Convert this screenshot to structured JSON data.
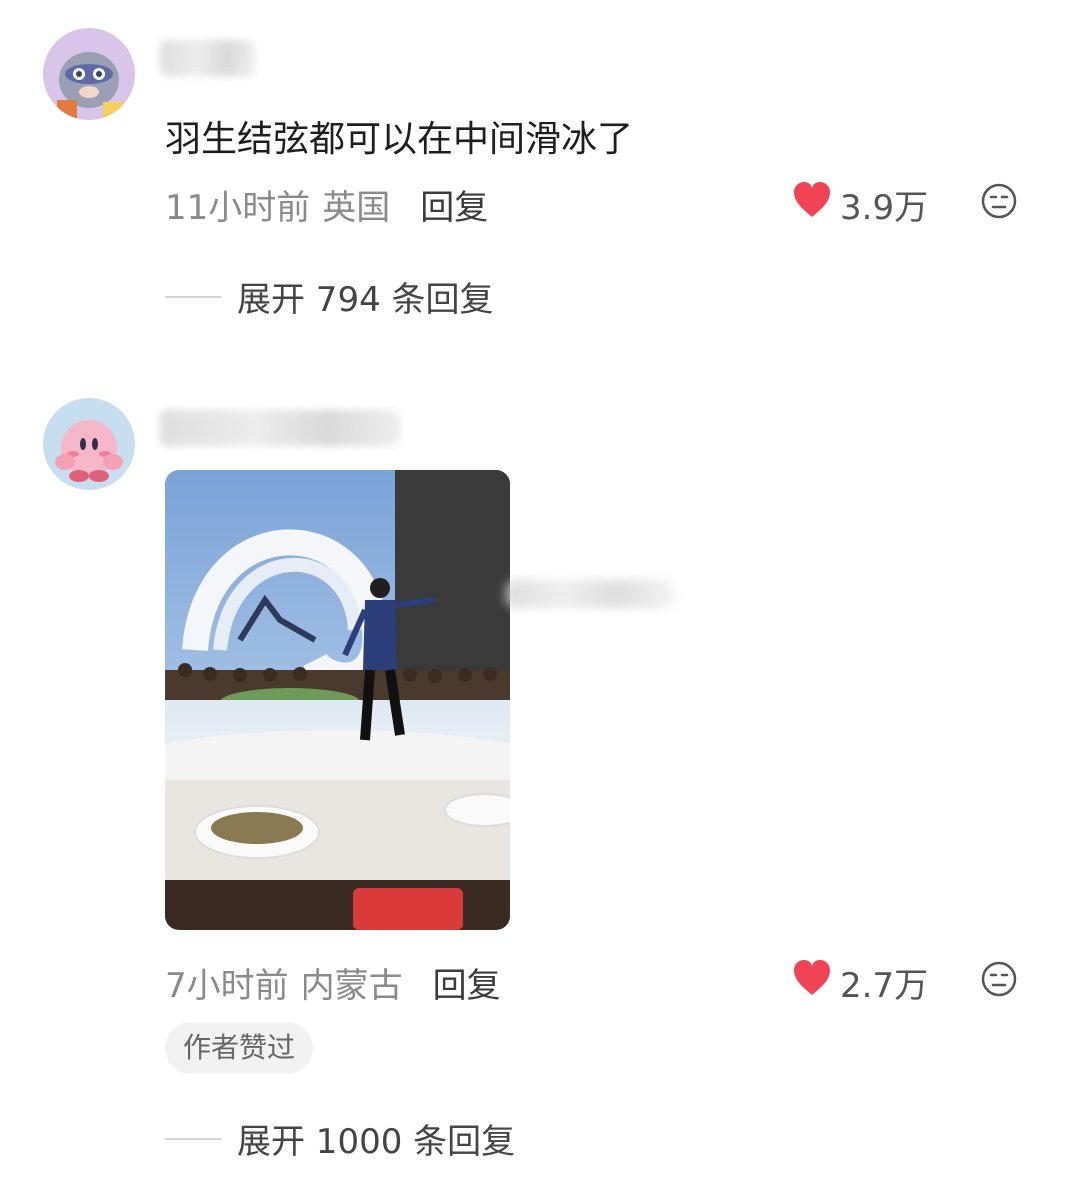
{
  "comments": [
    {
      "text": "羽生结弦都可以在中间滑冰了",
      "time": "11小时前",
      "location": "英国",
      "reply_label": "回复",
      "likes": "3.9万",
      "expand_label": "展开 794 条回复"
    },
    {
      "time": "7小时前",
      "location": "内蒙古",
      "reply_label": "回复",
      "likes": "2.7万",
      "badge": "作者赞过",
      "expand_label": "展开 1000 条回复"
    }
  ],
  "colors": {
    "heart": "#f04455",
    "meta_text": "#8a8a8a",
    "badge_bg": "#f2f2f2"
  },
  "icons": {
    "like": "heart-icon",
    "dislike": "neutral-face-icon"
  }
}
